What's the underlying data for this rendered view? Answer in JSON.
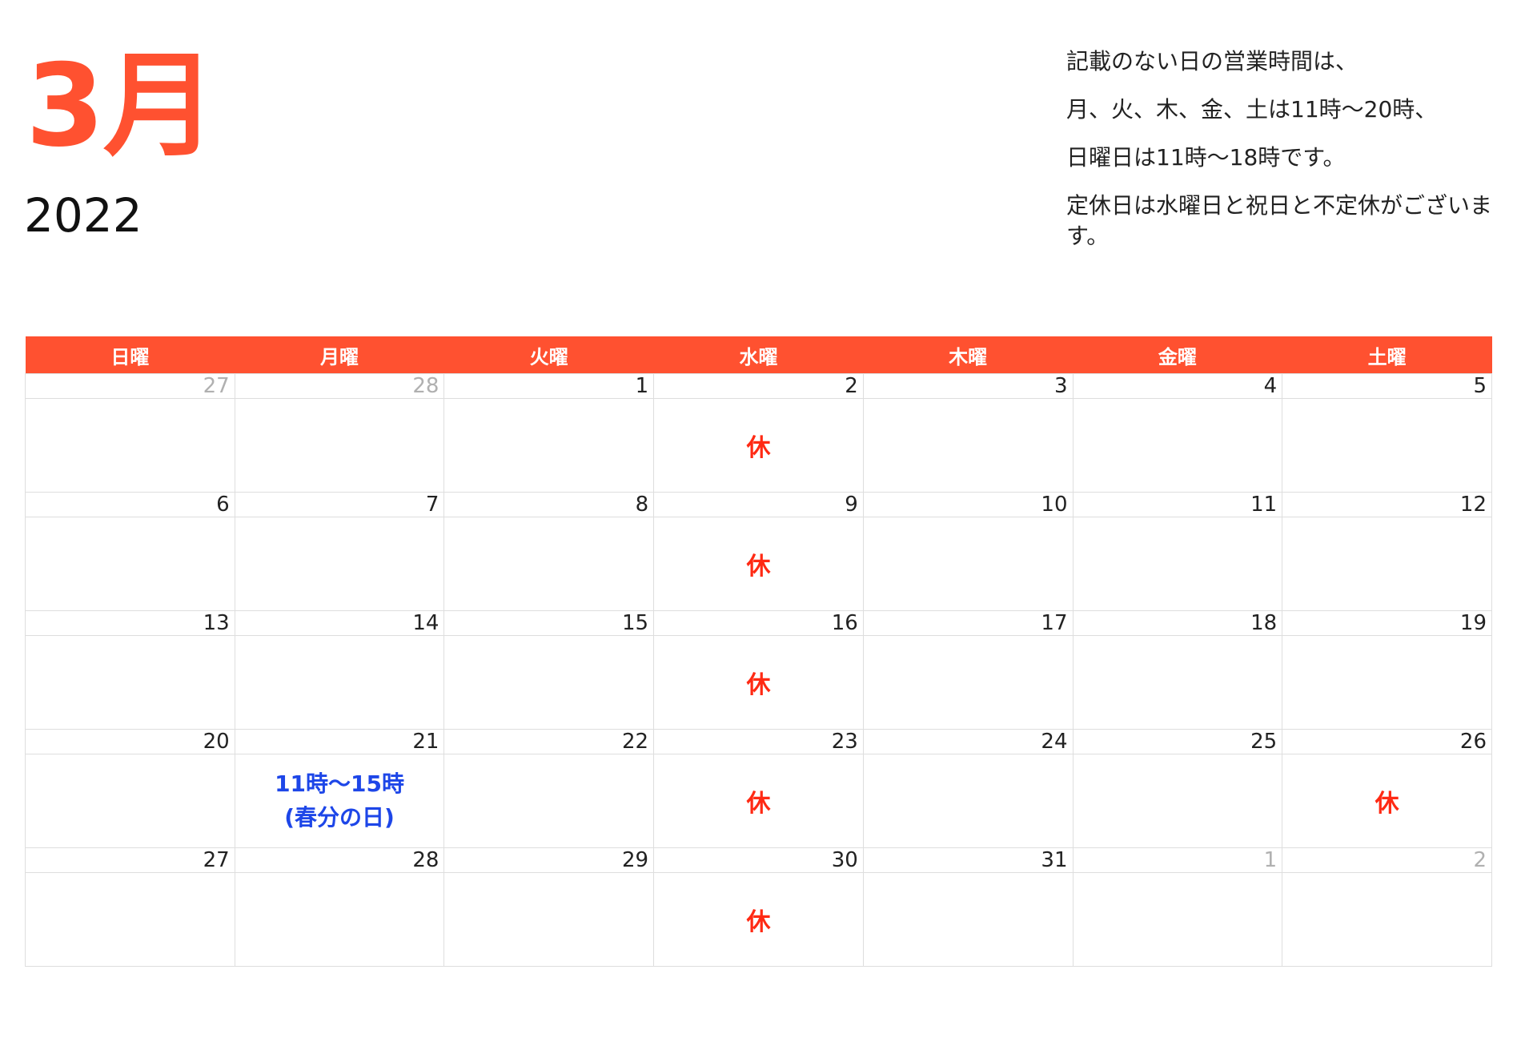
{
  "header": {
    "month": "3月",
    "year": "2022"
  },
  "notes": [
    "記載のない日の営業時間は、",
    "月、火、木、金、土は11時〜20時、",
    "日曜日は11時〜18時です。",
    "定休日は水曜日と祝日と不定休がございます。"
  ],
  "colors": {
    "accent": "#ff5130",
    "closed": "#ff2a14",
    "special": "#1d46e8",
    "grid": "#dedede",
    "other_month": "#b0b0b0"
  },
  "weekdays": [
    "日曜",
    "月曜",
    "火曜",
    "水曜",
    "木曜",
    "金曜",
    "土曜"
  ],
  "weeks": [
    [
      {
        "day": "27",
        "other": true,
        "note": ""
      },
      {
        "day": "28",
        "other": true,
        "note": ""
      },
      {
        "day": "1",
        "note": ""
      },
      {
        "day": "2",
        "note": "休",
        "closed": true
      },
      {
        "day": "3",
        "note": ""
      },
      {
        "day": "4",
        "note": ""
      },
      {
        "day": "5",
        "note": ""
      }
    ],
    [
      {
        "day": "6",
        "note": ""
      },
      {
        "day": "7",
        "note": ""
      },
      {
        "day": "8",
        "note": ""
      },
      {
        "day": "9",
        "note": "休",
        "closed": true
      },
      {
        "day": "10",
        "note": ""
      },
      {
        "day": "11",
        "note": ""
      },
      {
        "day": "12",
        "note": ""
      }
    ],
    [
      {
        "day": "13",
        "note": ""
      },
      {
        "day": "14",
        "note": ""
      },
      {
        "day": "15",
        "note": ""
      },
      {
        "day": "16",
        "note": "休",
        "closed": true
      },
      {
        "day": "17",
        "note": ""
      },
      {
        "day": "18",
        "note": ""
      },
      {
        "day": "19",
        "note": ""
      }
    ],
    [
      {
        "day": "20",
        "note": ""
      },
      {
        "day": "21",
        "note": "11時〜15時",
        "note2": "(春分の日)",
        "special": true
      },
      {
        "day": "22",
        "note": ""
      },
      {
        "day": "23",
        "note": "休",
        "closed": true
      },
      {
        "day": "24",
        "note": ""
      },
      {
        "day": "25",
        "note": ""
      },
      {
        "day": "26",
        "note": "休",
        "closed": true
      }
    ],
    [
      {
        "day": "27",
        "note": ""
      },
      {
        "day": "28",
        "note": ""
      },
      {
        "day": "29",
        "note": ""
      },
      {
        "day": "30",
        "note": "休",
        "closed": true
      },
      {
        "day": "31",
        "note": ""
      },
      {
        "day": "1",
        "other": true,
        "note": ""
      },
      {
        "day": "2",
        "other": true,
        "note": ""
      }
    ]
  ]
}
